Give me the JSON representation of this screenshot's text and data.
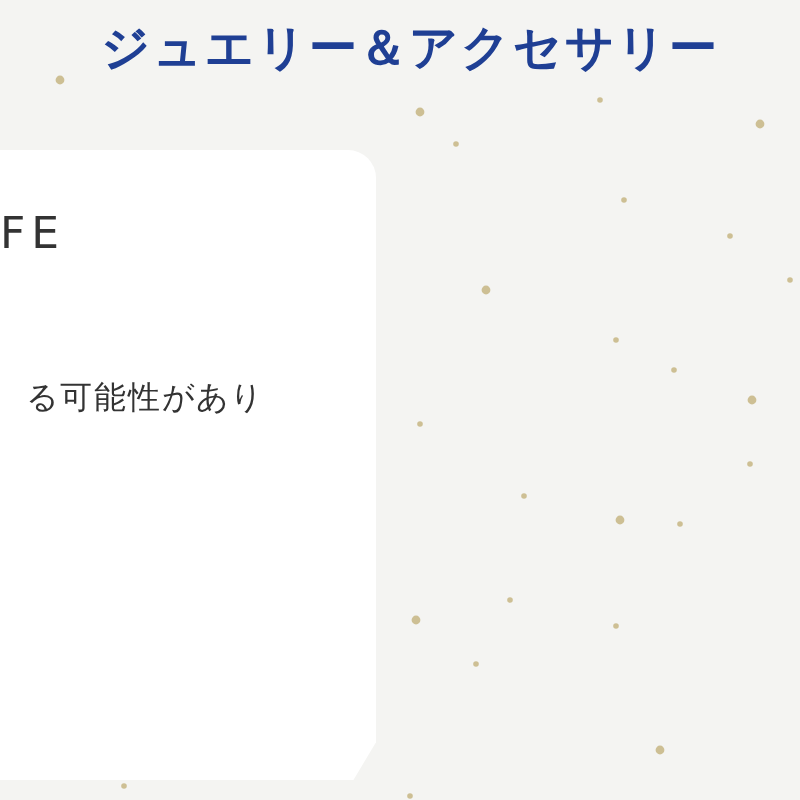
{
  "heading": "ジュエリー＆アクセサリー",
  "card": {
    "title": "FE",
    "text": "る可能性があり"
  }
}
